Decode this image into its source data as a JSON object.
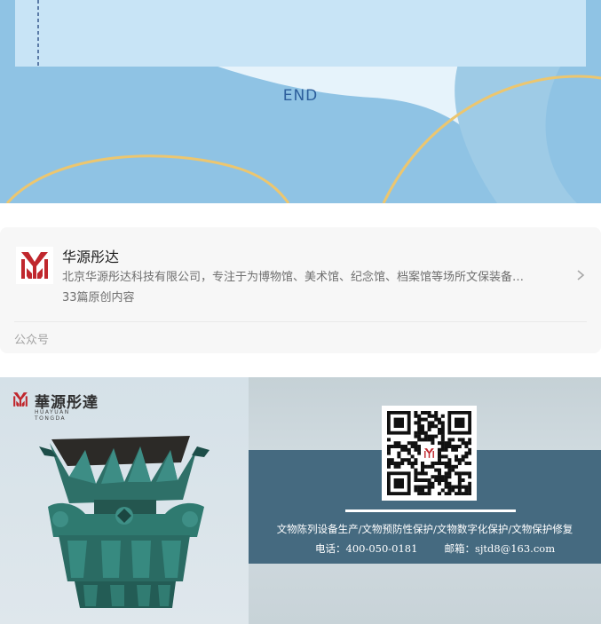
{
  "top_banner": {
    "end_label": "END"
  },
  "account_card": {
    "name": "华源彤达",
    "description": "北京华源彤达科技有限公司，专注于为博物馆、美术馆、纪念馆、档案馆等场所文保装备…",
    "article_count": "33篇原创内容",
    "type_label": "公众号"
  },
  "promo": {
    "brand_cn": "華源彤達",
    "brand_en": "HUAYUAN TONGDA",
    "services": "文物陈列设备生产/文物预防性保护/文物数字化保护/文物保护修复",
    "phone": "电话：400-050-0181",
    "email": "邮箱：sjtd8@163.com"
  },
  "colors": {
    "banner_blue": "#8fc3e4",
    "panel_blue": "#c8e4f6",
    "wave_gold": "#ecc66f",
    "end_text": "#2d5f9c",
    "brand_red": "#c0272d",
    "promo_band": "#456a80"
  },
  "icons": [
    "brand-logo-icon",
    "chevron-right-icon",
    "qr-code-icon"
  ]
}
